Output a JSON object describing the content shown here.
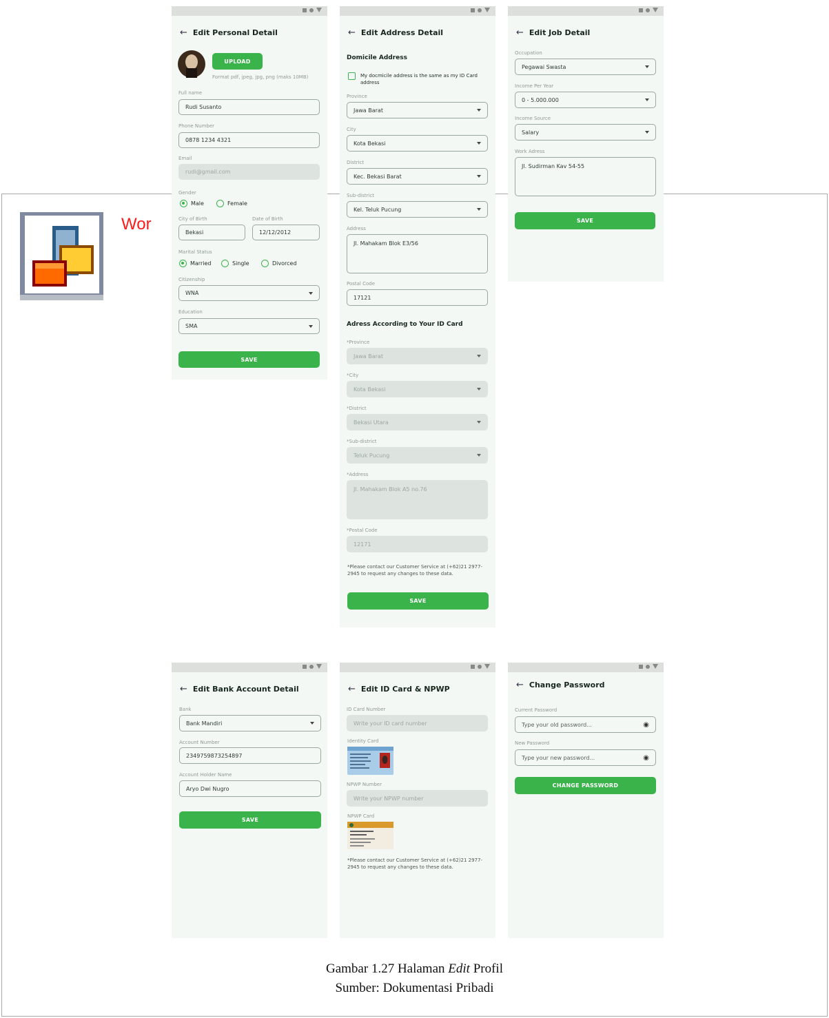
{
  "document": {
    "word_fragment": "Wor",
    "caption_line1": "Gambar 1.27 Halaman",
    "caption_italic": "Edit",
    "caption_line1_end": "Profil",
    "caption_line2": "Sumber: Dokumentasi Pribadi"
  },
  "personal": {
    "title": "Edit Personal Detail",
    "upload_label": "UPLOAD",
    "upload_hint": "Format pdf, jpeg, jpg, png (maks 10MB)",
    "fullname_label": "Full name",
    "fullname_value": "Rudi Susanto",
    "phone_label": "Phone Number",
    "phone_value": "0878 1234 4321",
    "email_label": "Email",
    "email_value": "rudi@gmail.com",
    "gender_label": "Gender",
    "gender_male": "Male",
    "gender_female": "Female",
    "city_birth_label": "City of Birth",
    "city_birth_value": "Bekasi",
    "dob_label": "Date of Birth",
    "dob_value": "12/12/2012",
    "marital_label": "Marital Status",
    "marital_married": "Married",
    "marital_single": "Single",
    "marital_divorced": "Divorced",
    "citizenship_label": "Citizenship",
    "citizenship_value": "WNA",
    "education_label": "Education",
    "education_value": "SMA",
    "save_label": "SAVE"
  },
  "address": {
    "title": "Edit Address Detail",
    "domicile_section": "Domicile Address",
    "same_checkbox": "My docmicile address is the same as my ID Card address",
    "province_label": "Province",
    "province_value": "Jawa Barat",
    "city_label": "City",
    "city_value": "Kota Bekasi",
    "district_label": "District",
    "district_value": "Kec. Bekasi Barat",
    "subdistrict_label": "Sub-district",
    "subdistrict_value": "Kel. Teluk Pucung",
    "address_label": "Address",
    "address_value": "Jl. Mahakam Blok E3/56",
    "postal_label": "Postal Code",
    "postal_value": "17121",
    "idcard_section": "Adress According to Your ID Card",
    "id_province_label": "*Province",
    "id_province_value": "Jawa Barat",
    "id_city_label": "*City",
    "id_city_value": "Kota Bekasi",
    "id_district_label": "*District",
    "id_district_value": "Bekasi Utara",
    "id_subdistrict_label": "*Sub-district",
    "id_subdistrict_value": "Teluk Pucung",
    "id_address_label": "*Address",
    "id_address_value": "Jl. Mahakam Blok A5 no.76",
    "id_postal_label": "*Postal Code",
    "id_postal_value": "12171",
    "note": "*Please contact our Customer Service at (+62)21 2977-2945 to request any changes to these data.",
    "save_label": "SAVE"
  },
  "job": {
    "title": "Edit Job Detail",
    "occupation_label": "Occupation",
    "occupation_value": "Pegawai Swasta",
    "income_label": "Income Per Year",
    "income_value": "0 - 5.000.000",
    "source_label": "Income Source",
    "source_value": "Salary",
    "work_label": "Work Adress",
    "work_value": "Jl. Sudirman Kav 54-55",
    "save_label": "SAVE"
  },
  "bank": {
    "title": "Edit Bank Account Detail",
    "bank_label": "Bank",
    "bank_value": "Bank Mandiri",
    "account_label": "Account Number",
    "account_value": "2349759873254897",
    "holder_label": "Account Holder Name",
    "holder_value": "Aryo Dwi Nugro",
    "save_label": "SAVE"
  },
  "idcard": {
    "title": "Edit ID Card & NPWP",
    "id_number_label": "ID Card Number",
    "id_number_placeholder": "Write your ID card number",
    "identity_label": "Identity Card",
    "npwp_number_label": "NPWP Number",
    "npwp_placeholder": "Write your NPWP number",
    "npwp_card_label": "NPWP Card",
    "note": "*Please contact our Customer Service at (+62)21 2977-2945 to request any changes to these data."
  },
  "password": {
    "title": "Change Password",
    "current_label": "Current  Password",
    "current_placeholder": "Type your old password...",
    "new_label": "New Password",
    "new_placeholder": "Type your new password...",
    "button_label": "CHANGE PASSWORD"
  },
  "colors": {
    "accent": "#39b34a",
    "screen_bg": "#f4f8f4",
    "disabled_field": "#dde3de",
    "word_red": "#ff1a1a"
  },
  "icons": {
    "back": "arrow-left-icon",
    "dropdown": "chevron-down-icon",
    "password_toggle": "eye-icon"
  }
}
